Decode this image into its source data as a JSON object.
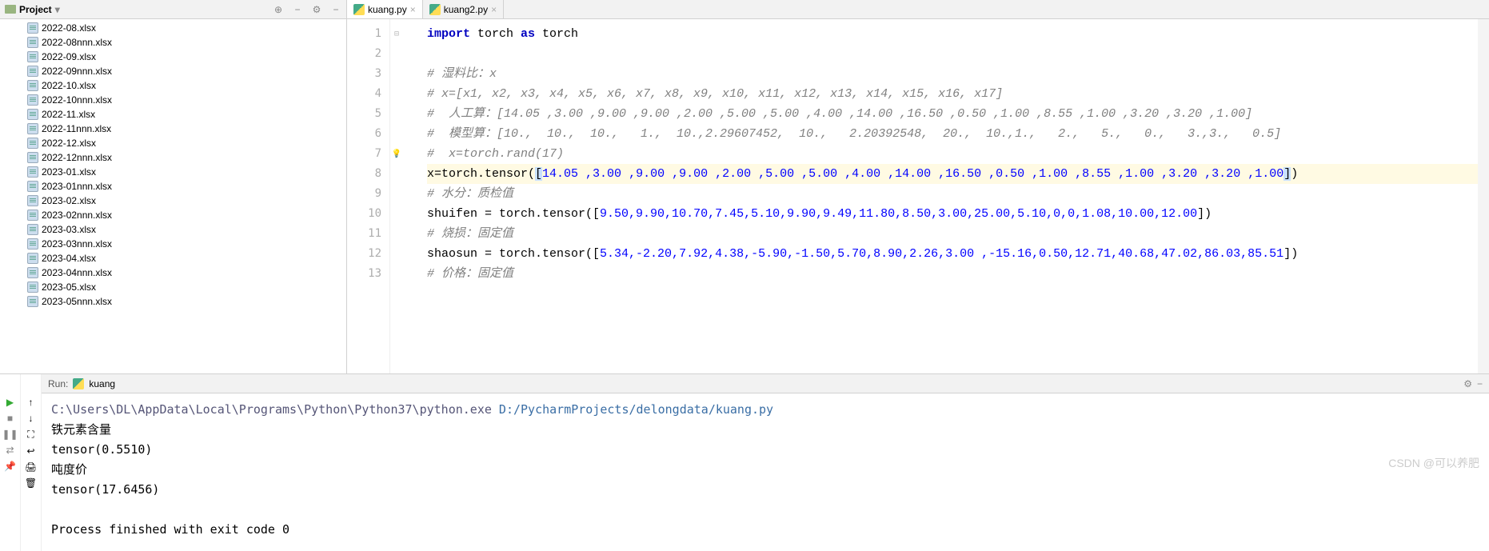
{
  "sidebar": {
    "title": "Project",
    "files": [
      "2022-08.xlsx",
      "2022-08nnn.xlsx",
      "2022-09.xlsx",
      "2022-09nnn.xlsx",
      "2022-10.xlsx",
      "2022-10nnn.xlsx",
      "2022-11.xlsx",
      "2022-11nnn.xlsx",
      "2022-12.xlsx",
      "2022-12nnn.xlsx",
      "2023-01.xlsx",
      "2023-01nnn.xlsx",
      "2023-02.xlsx",
      "2023-02nnn.xlsx",
      "2023-03.xlsx",
      "2023-03nnn.xlsx",
      "2023-04.xlsx",
      "2023-04nnn.xlsx",
      "2023-05.xlsx",
      "2023-05nnn.xlsx"
    ]
  },
  "tabs": [
    {
      "label": "kuang.py",
      "active": true
    },
    {
      "label": "kuang2.py",
      "active": false
    }
  ],
  "code": {
    "lines_count": 13,
    "l1_kw_import": "import",
    "l1_torch1": " torch ",
    "l1_kw_as": "as",
    "l1_torch2": " torch",
    "l3_cm": "# 湿料比：x",
    "l4_cm": "# x=[x1, x2, x3, x4, x5, x6, x7, x8, x9, x10, x11, x12, x13, x14, x15, x16, x17]",
    "l5_cm": "#  人工算：[14.05 ,3.00 ,9.00 ,9.00 ,2.00 ,5.00 ,5.00 ,4.00 ,14.00 ,16.50 ,0.50 ,1.00 ,8.55 ,1.00 ,3.20 ,3.20 ,1.00]",
    "l6_cm": "#  模型算：[10.,  10.,  10.,   1.,  10.,2.29607452,  10.,   2.20392548,  20.,  10.,1.,   2.,   5.,   0.,   3.,3.,   0.5]",
    "l7_cm": "#  x=torch.rand(17)",
    "l8_pre": "x=torch.tensor(",
    "l8_nums": "14.05 ,3.00 ,9.00 ,9.00 ,2.00 ,5.00 ,5.00 ,4.00 ,14.00 ,16.50 ,0.50 ,1.00 ,8.55 ,1.00 ,3.20 ,3.20 ,1.00",
    "l9_cm": "# 水分：质检值",
    "l10_pre": "shuifen = torch.tensor([",
    "l10_nums": "9.50,9.90,10.70,7.45,5.10,9.90,9.49,11.80,8.50,3.00,25.00,5.10,0,0,1.08,10.00,12.00",
    "l10_post": "])",
    "l11_cm": "# 烧损：固定值",
    "l12_pre": "shaosun = torch.tensor([",
    "l12_nums": "5.34,-2.20,7.92,4.38,-5.90,-1.50,5.70,8.90,2.26,3.00 ,-15.16,0.50,12.71,40.68,47.02,86.03,85.51",
    "l12_post": "])",
    "l13_cm": "# 价格：固定值"
  },
  "run": {
    "label": "Run:",
    "config": "kuang",
    "cmd_exe": "C:\\Users\\DL\\AppData\\Local\\Programs\\Python\\Python37\\python.exe ",
    "cmd_arg": "D:/PycharmProjects/delongdata/kuang.py",
    "out1": "铁元素含量",
    "out2": "tensor(0.5510)",
    "out3": "吨度价",
    "out4": "tensor(17.6456)",
    "exit": "Process finished with exit code 0"
  },
  "watermark": "CSDN @可以养肥",
  "icons": {
    "target": "⊕",
    "collapse": "−",
    "gear": "⚙",
    "hide": "−",
    "play": "▶",
    "stop": "■",
    "pause": "❚❚",
    "layout": "⇄",
    "up": "↑",
    "down": "↓",
    "filter": "⛶",
    "wrap": "↩",
    "print": "🖨",
    "trash": "🗑",
    "pin": "📌"
  }
}
